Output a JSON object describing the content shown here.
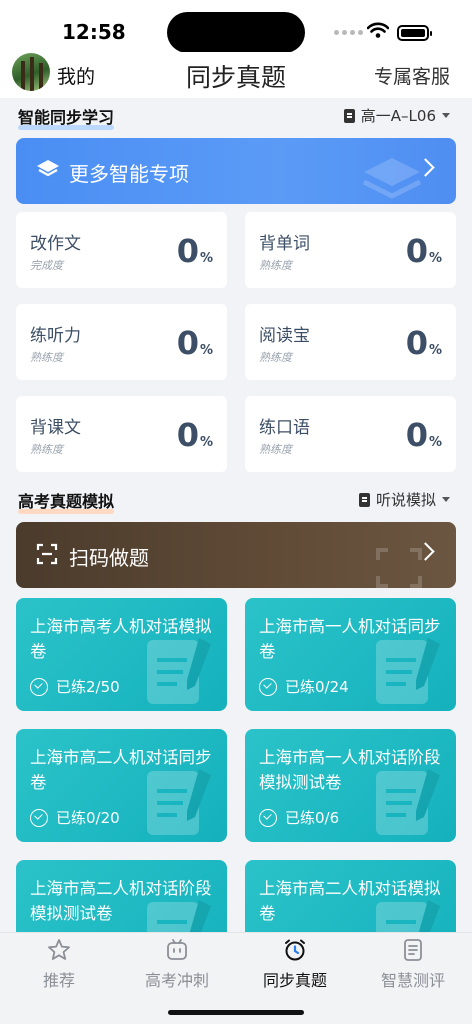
{
  "status_bar": {
    "time": "12:58"
  },
  "nav": {
    "my_label": "我的",
    "title": "同步真题",
    "service_label": "专属客服"
  },
  "sync_section": {
    "title": "智能同步学习",
    "book_selector": "高一A–L06",
    "banner_label": "更多智能专项",
    "cards": [
      {
        "label": "改作文",
        "sub": "完成度",
        "value": "0",
        "unit": "%"
      },
      {
        "label": "背单词",
        "sub": "熟练度",
        "value": "0",
        "unit": "%"
      },
      {
        "label": "练听力",
        "sub": "熟练度",
        "value": "0",
        "unit": "%"
      },
      {
        "label": "阅读宝",
        "sub": "熟练度",
        "value": "0",
        "unit": "%"
      },
      {
        "label": "背课文",
        "sub": "熟练度",
        "value": "0",
        "unit": "%"
      },
      {
        "label": "练口语",
        "sub": "熟练度",
        "value": "0",
        "unit": "%"
      }
    ]
  },
  "exam_section": {
    "title": "高考真题模拟",
    "mode_selector": "听说模拟",
    "banner_label": "扫码做题",
    "papers": [
      {
        "title": "上海市高考人机对话模拟卷",
        "progress": "已练2/50"
      },
      {
        "title": "上海市高一人机对话同步卷",
        "progress": "已练0/24"
      },
      {
        "title": "上海市高二人机对话同步卷",
        "progress": "已练0/20"
      },
      {
        "title": "上海市高一人机对话阶段模拟测试卷",
        "progress": "已练0/6"
      },
      {
        "title": "上海市高二人机对话阶段模拟测试卷",
        "progress": ""
      },
      {
        "title": "上海市高二人机对话模拟卷",
        "progress": ""
      }
    ]
  },
  "tab_bar": {
    "active": "同步真题",
    "items": [
      {
        "label": "推荐",
        "icon": "star-icon"
      },
      {
        "label": "高考冲刺",
        "icon": "robot-icon"
      },
      {
        "label": "同步真题",
        "icon": "alarm-clock-icon"
      },
      {
        "label": "智慧测评",
        "icon": "document-icon"
      }
    ]
  },
  "colors": {
    "primary_blue": "#4a8ef4",
    "teal_card": "#1bb8c3",
    "brown_banner": "#5a4634",
    "text_dark": "#3d4f66"
  }
}
